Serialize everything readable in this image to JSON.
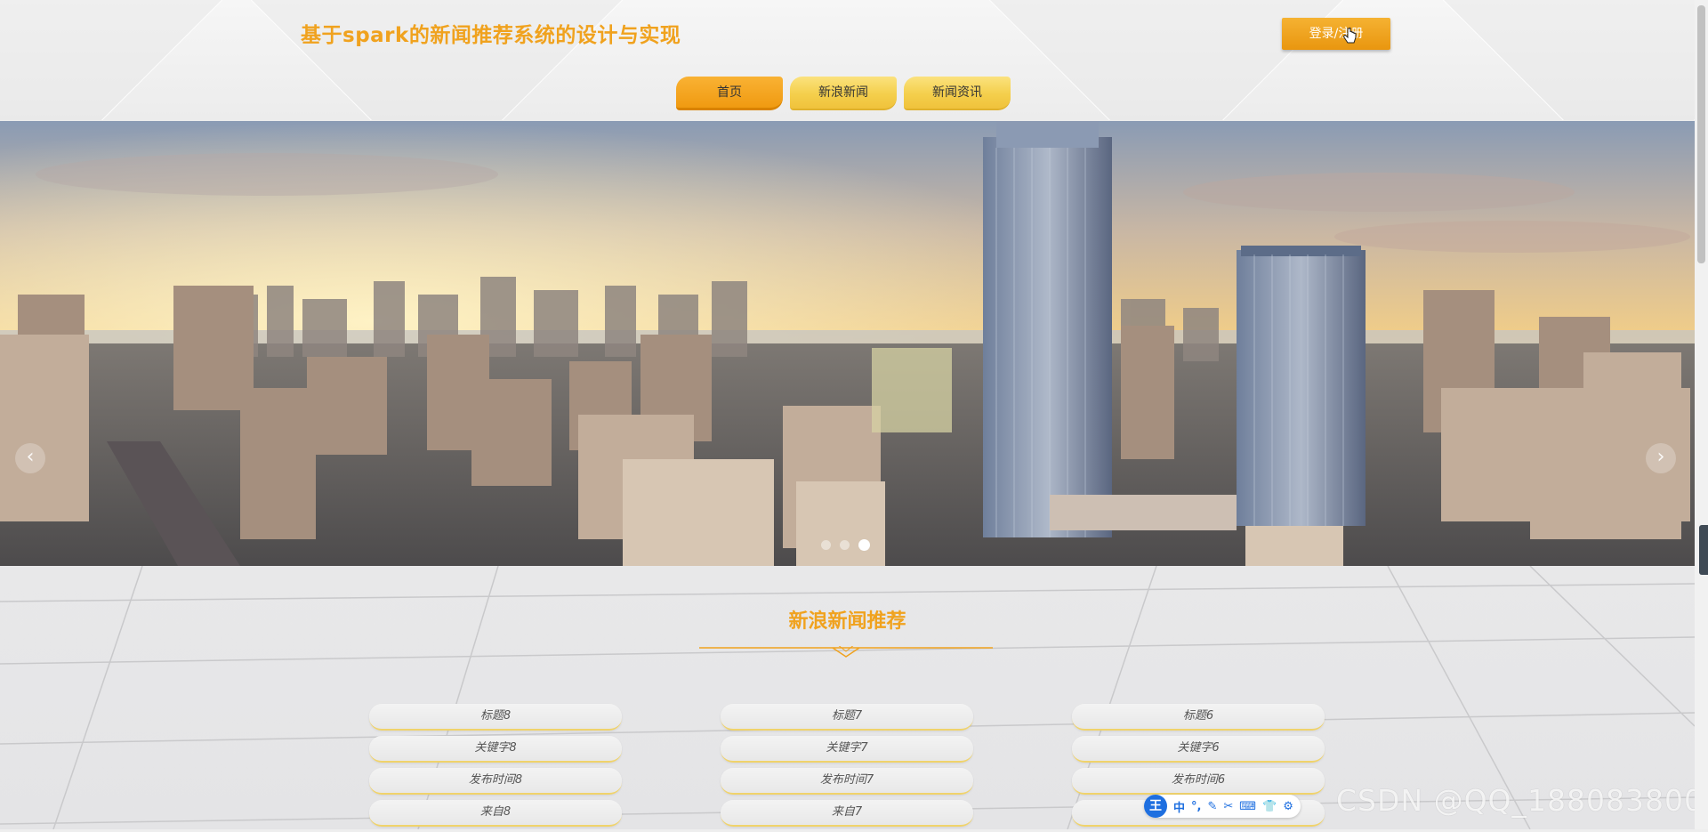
{
  "header": {
    "site_title": "基于spark的新闻推荐系统的设计与实现",
    "login_label": "登录/注册",
    "nav": [
      {
        "label": "首页",
        "active": true
      },
      {
        "label": "新浪新闻",
        "active": false
      },
      {
        "label": "新闻资讯",
        "active": false
      }
    ]
  },
  "banner": {
    "prev_icon": "chevron-left-icon",
    "next_icon": "chevron-right-icon",
    "slide_count": 3,
    "active_slide": 3
  },
  "section": {
    "title": "新浪新闻推荐",
    "cards": [
      {
        "title": "标题8",
        "keyword": "关键字8",
        "time": "发布时间8",
        "source": "来自8"
      },
      {
        "title": "标题7",
        "keyword": "关键字7",
        "time": "发布时间7",
        "source": "来自7"
      },
      {
        "title": "标题6",
        "keyword": "关键字6",
        "time": "发布时间6",
        "source": ""
      }
    ]
  },
  "overlays": {
    "ime_items": [
      "中",
      "°,",
      "✎",
      "✂",
      "⌨",
      "👕",
      "⚙"
    ],
    "ime_logo": "王",
    "watermark": "CSDN @QQ_188083800"
  },
  "colors": {
    "accent_orange": "#f0a21e",
    "nav_yellow": "#f4cf4c",
    "login_orange": "#e9960f"
  }
}
